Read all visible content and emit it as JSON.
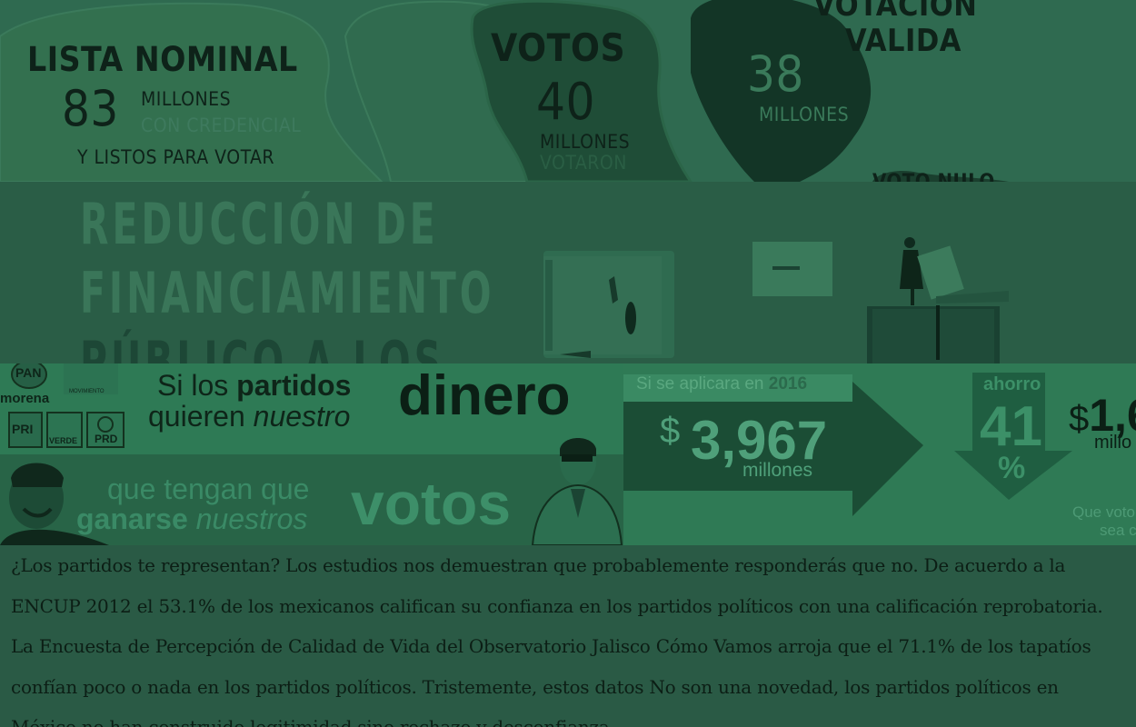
{
  "colors": {
    "page_background": "#2a5a45",
    "dark_text": "#0c1e15",
    "light_green": "#3e7a5e"
  },
  "stats_panel": {
    "lista_nominal": {
      "title": "LISTA NOMINAL",
      "number": "83",
      "unit": "MILLONES",
      "sub1": "CON CREDENCIAL",
      "sub2": "Y LISTOS PARA VOTAR"
    },
    "votos": {
      "title": "VOTOS",
      "number": "40",
      "unit": "MILLONES",
      "sub": "VOTARON"
    },
    "votacion_valida": {
      "title_line1": "VOTACION",
      "title_line2": "VALIDA",
      "number": "38",
      "unit": "MILLONES",
      "partial": "VOTO NULO"
    }
  },
  "banner": {
    "line1": "Reducción de",
    "line2": "financiamiento",
    "line3": "público a los"
  },
  "ad": {
    "slogan_si_los": "Si los",
    "slogan_partidos": "partidos",
    "slogan_quieren": "quieren",
    "slogan_nuestro": "nuestro",
    "slogan_dinero": "dinero",
    "slogan_que_tengan": "que tengan que",
    "slogan_ganarse": "ganarse",
    "slogan_nuestros": "nuestros",
    "slogan_votos": "votos",
    "logos": [
      "PAN",
      "morena",
      "PRI",
      "VERDE",
      "PRD"
    ],
    "logo_small": "MOVIMIENTO"
  },
  "savings": {
    "header_prefix": "Si se aplicara en",
    "header_year": "2016",
    "currency": "$",
    "amount": "3,967",
    "amount_unit": "millones",
    "ahorro_label": "ahorro",
    "ahorro_value": "41",
    "ahorro_pct": "%",
    "right_amount": "1,6",
    "right_unit": "millo",
    "footnote_line1": "Que voto",
    "footnote_line2": "sea c"
  },
  "article": {
    "paragraph": "¿Los partidos te representan? Los estudios nos demuestran que probablemente responderás que no. De acuerdo a la ENCUP 2012 el 53.1% de los mexicanos califican su confianza en los partidos políticos con una calificación reprobatoria. La Encuesta de Percepción de Calidad de Vida del Observatorio Jalisco Cómo Vamos arroja que el 71.1% de los tapatíos confían poco o nada en los partidos políticos. Tristemente, estos datos No son una novedad, los partidos políticos en México no han construido legitimidad sino rechazo y desconfianza."
  }
}
